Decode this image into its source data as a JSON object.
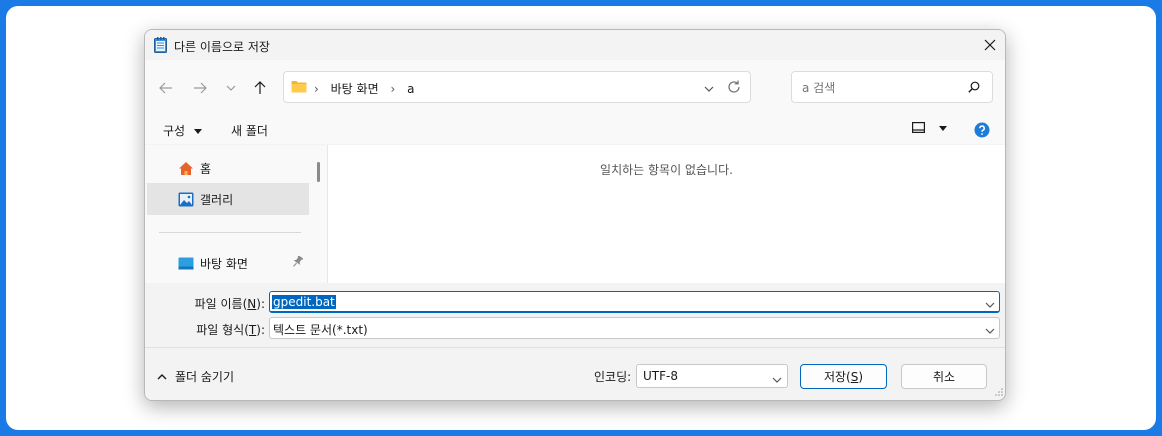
{
  "window": {
    "title": "다른 이름으로 저장",
    "icon": "notepad-icon"
  },
  "nav": {
    "back_icon": "arrow-left-icon",
    "forward_icon": "arrow-right-icon",
    "recent_icon": "chevron-down-icon",
    "up_icon": "arrow-up-icon",
    "breadcrumbs": [
      "바탕 화면",
      "a"
    ],
    "search_placeholder": "a 검색"
  },
  "toolbar": {
    "organize_label": "구성",
    "new_folder_label": "새 폴더"
  },
  "sidebar": {
    "items": [
      {
        "label": "홈",
        "icon": "home-icon"
      },
      {
        "label": "갤러리",
        "icon": "gallery-icon",
        "selected": true
      },
      {
        "label": "바탕 화면",
        "icon": "desktop-icon",
        "pinned": true
      }
    ]
  },
  "content": {
    "empty_message": "일치하는 항목이 없습니다."
  },
  "fields": {
    "filename_label": "파일 이름(",
    "filename_key": "N",
    "filename_label_end": "):",
    "filename_value": "gpedit.bat",
    "filetype_label": "파일 형식(",
    "filetype_key": "T",
    "filetype_label_end": "):",
    "filetype_value": "텍스트 문서(*.txt)"
  },
  "footer": {
    "hide_folders_label": "폴더 숨기기",
    "encoding_label": "인코딩:",
    "encoding_value": "UTF-8",
    "save_label": "저장(",
    "save_key": "S",
    "save_label_end": ")",
    "cancel_label": "취소"
  },
  "colors": {
    "accent": "#0067c0",
    "background": "#1a7ae6"
  }
}
